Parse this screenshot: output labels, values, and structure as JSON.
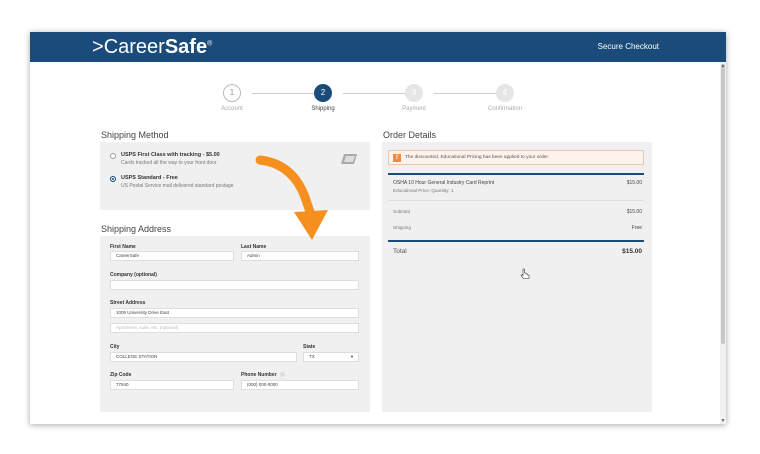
{
  "header": {
    "logo_prefix": "Career",
    "logo_bold": "Safe",
    "logo_reg": "®",
    "secure_checkout": "Secure Checkout"
  },
  "steps": [
    {
      "number": "1",
      "label": "Account",
      "state": "done"
    },
    {
      "number": "2",
      "label": "Shipping",
      "state": "active"
    },
    {
      "number": "3",
      "label": "Payment",
      "state": "future"
    },
    {
      "number": "4",
      "label": "Confirmation",
      "state": "future"
    }
  ],
  "shipping_method": {
    "title": "Shipping Method",
    "options": [
      {
        "title": "USPS First Class with tracking - $5.00",
        "subtitle": "Cards tracked all the way to your front door",
        "selected": false
      },
      {
        "title": "USPS Standard - Free",
        "subtitle": "US Postal Service mail delivered standard postage",
        "selected": true
      }
    ],
    "icon": "usps-card-icon"
  },
  "shipping_address": {
    "title": "Shipping Address",
    "first_name": {
      "label": "First Name",
      "value": "CareerSafe"
    },
    "last_name": {
      "label": "Last Name",
      "value": "Admin"
    },
    "company": {
      "label": "Company (optional)",
      "value": ""
    },
    "street": {
      "label": "Street Address",
      "value": "1005 University Drive East",
      "line2_placeholder": "Apartment, suite, etc. (optional)"
    },
    "city": {
      "label": "City",
      "value": "COLLEGE STATION"
    },
    "state": {
      "label": "State",
      "value": "TX"
    },
    "zip": {
      "label": "Zip Code",
      "value": "77840"
    },
    "phone": {
      "label": "Phone Number",
      "placeholder": "(000) 000-0000"
    }
  },
  "order_details": {
    "title": "Order Details",
    "alert": "The discounted, Educational Pricing has been applied to your order.",
    "item_name": "OSHA 10 Hour General Industry Card Reprint",
    "item_meta": "Educational Price; Quantity: 1",
    "item_price": "$15.00",
    "subtotal_label": "Subtotal",
    "subtotal_value": "$15.00",
    "shipping_label": "Shipping",
    "shipping_value": "Free",
    "total_label": "Total",
    "total_value": "$15.00"
  },
  "colors": {
    "brand_navy": "#1a4b7a",
    "accent_orange": "#f58a3c"
  }
}
